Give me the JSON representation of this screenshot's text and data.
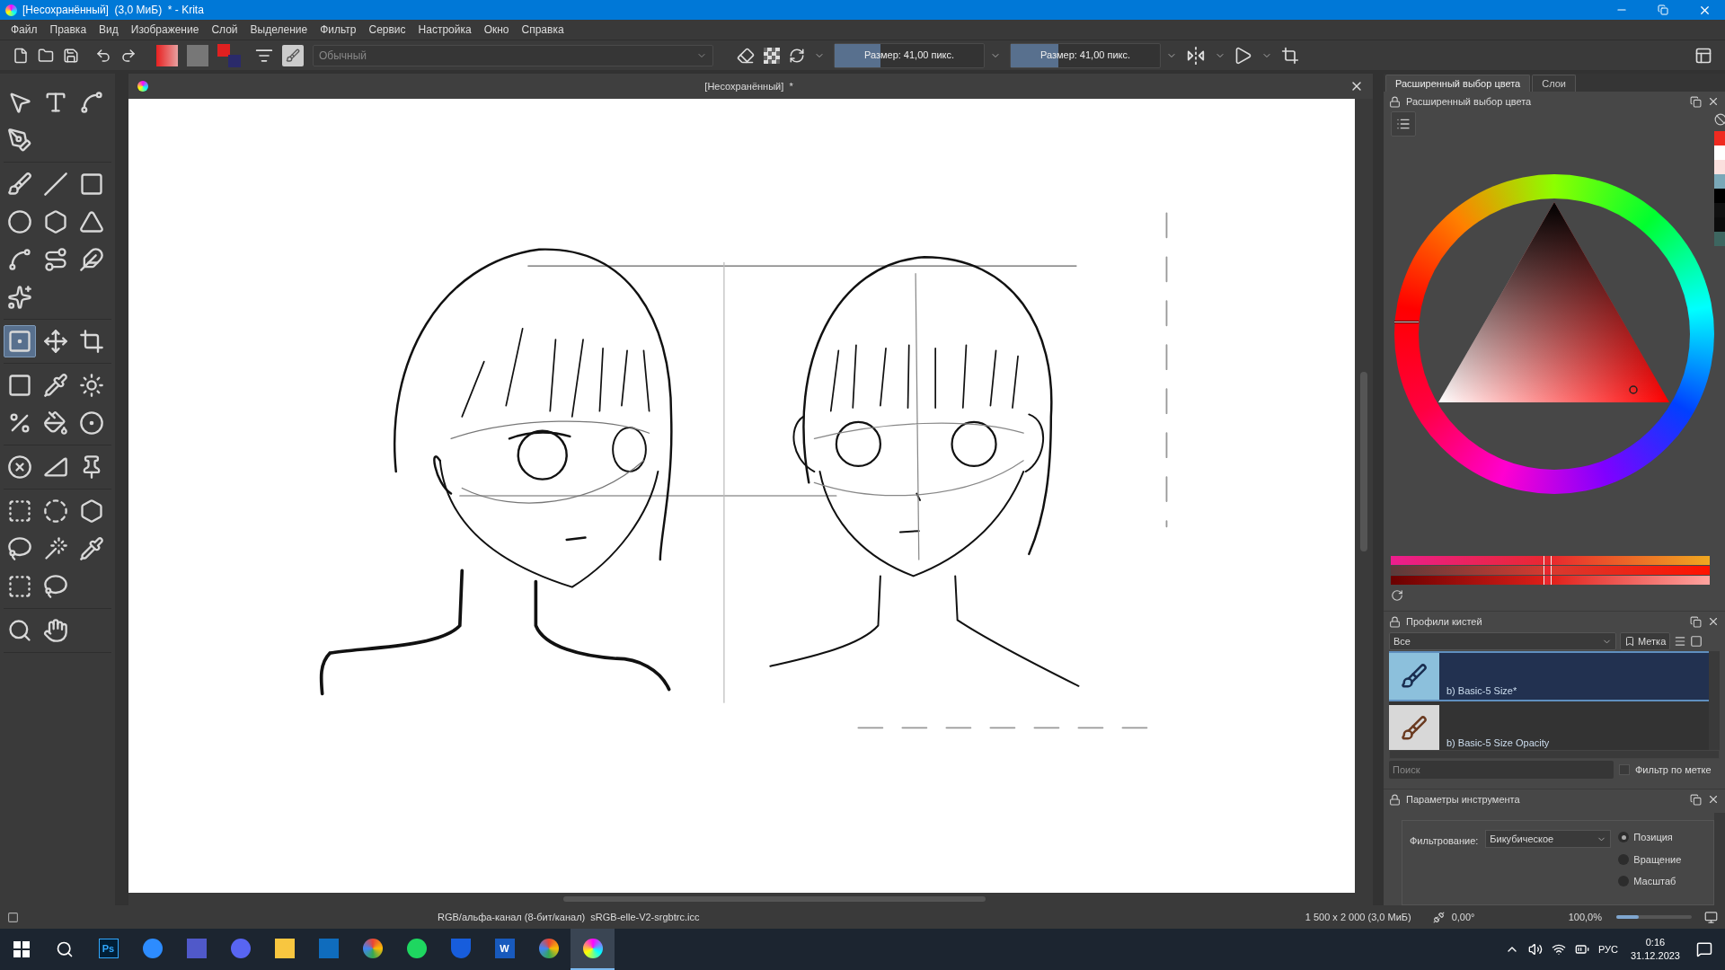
{
  "window": {
    "title": "[Несохранённый]  (3,0 МиБ)  * - Krita"
  },
  "menu": [
    "Файл",
    "Правка",
    "Вид",
    "Изображение",
    "Слой",
    "Выделение",
    "Фильтр",
    "Сервис",
    "Настройка",
    "Окно",
    "Справка"
  ],
  "toolbar": {
    "blend_mode": "Обычный",
    "size_fields": [
      {
        "text": "Размер: 41,00 пикс.",
        "level": 0.31
      },
      {
        "text": "Размер: 41,00 пикс.",
        "level": 0.32
      }
    ]
  },
  "toolbox": {
    "groups": [
      {
        "tools": [
          {
            "selected": false
          },
          {
            "selected": false
          },
          {
            "selected": false
          },
          {
            "selected": false
          }
        ]
      },
      {
        "tools": [
          {
            "selected": false
          },
          {
            "selected": false
          },
          {
            "selected": false
          },
          {
            "selected": false
          },
          {
            "selected": false
          },
          {
            "selected": false
          },
          {
            "selected": false
          },
          {
            "selected": false
          },
          {
            "selected": false
          },
          {
            "selected": false
          }
        ]
      },
      {
        "tools": [
          {
            "selected": true
          },
          {
            "selected": false
          },
          {
            "selected": false
          }
        ]
      },
      {
        "tools": [
          {
            "selected": false
          },
          {
            "selected": false
          },
          {
            "selected": false
          },
          {
            "selected": false
          },
          {
            "selected": false
          },
          {
            "selected": false
          }
        ]
      },
      {
        "tools": [
          {
            "selected": false
          },
          {
            "selected": false
          },
          {
            "selected": false
          }
        ]
      },
      {
        "tools": [
          {
            "selected": false
          },
          {
            "selected": false
          },
          {
            "selected": false
          },
          {
            "selected": false
          },
          {
            "selected": false
          },
          {
            "selected": false
          },
          {
            "selected": false
          },
          {
            "selected": false
          }
        ]
      },
      {
        "tools": [
          {
            "selected": false
          },
          {
            "selected": false
          }
        ]
      }
    ]
  },
  "document_tab": {
    "title": "[Несохранённый]  *"
  },
  "dock": {
    "tabs": [
      {
        "label": "Расширенный выбор цвета",
        "selected": true
      },
      {
        "label": "Слои",
        "selected": false
      }
    ],
    "color_panel": {
      "title": "Расширенный выбор цвета",
      "recent_colors": [
        {
          "color": "#f02a20"
        },
        {
          "color": "#ffffff"
        },
        {
          "color": "#fbe0de"
        },
        {
          "color": "#7aa8b8"
        },
        {
          "color": "#000000"
        },
        {
          "color": "#111111"
        },
        {
          "color": "#0c0c0c"
        },
        {
          "color": "#3d6660"
        }
      ],
      "sliders": [
        {
          "level": 0.49
        },
        {
          "level": 0.49
        },
        {
          "level": 0.49
        }
      ]
    },
    "brush_panel": {
      "title": "Профили кистей",
      "filter": "Все",
      "tag_button": "Метка",
      "presets": [
        {
          "name": "b) Basic-5 Size*",
          "selected": true
        },
        {
          "name": "b) Basic-5 Size Opacity",
          "selected": false
        }
      ],
      "search": {
        "placeholder": "Поиск"
      },
      "tag_filter": {
        "label": "Фильтр по метке",
        "checked": false
      }
    },
    "tool_options": {
      "title": "Параметры инструмента",
      "filter_label": "Фильтрование:",
      "filter_value": "Бикубическое",
      "modes": [
        {
          "label": "Позиция",
          "selected": true
        },
        {
          "label": "Вращение",
          "selected": false
        },
        {
          "label": "Масштаб",
          "selected": false
        }
      ]
    }
  },
  "status_bar": {
    "color_space": "RGB/альфа-канал (8-бит/канал)  sRGB-elle-V2-srgbtrc.icc",
    "dimensions": "1 500 x 2 000 (3,0 МиБ)",
    "rotation": "0,00°",
    "zoom": "100,0%",
    "zoom_slider": {
      "level": 0.3
    }
  },
  "taskbar": {
    "apps": [
      {
        "kind": "photoshop",
        "glyph": "Ps",
        "selected": false
      },
      {
        "kind": "zoom",
        "selected": false
      },
      {
        "kind": "teams",
        "selected": false
      },
      {
        "kind": "discord",
        "selected": false
      },
      {
        "kind": "explorer",
        "selected": false
      },
      {
        "kind": "store",
        "selected": false
      },
      {
        "kind": "chrome",
        "selected": false
      },
      {
        "kind": "spotify",
        "selected": false
      },
      {
        "kind": "shield",
        "selected": false
      },
      {
        "kind": "word",
        "glyph": "W",
        "selected": false
      },
      {
        "kind": "chrome",
        "selected": false
      },
      {
        "kind": "krita",
        "selected": true
      }
    ],
    "language": "РУС",
    "time": "0:16",
    "date": "31.12.2023"
  }
}
